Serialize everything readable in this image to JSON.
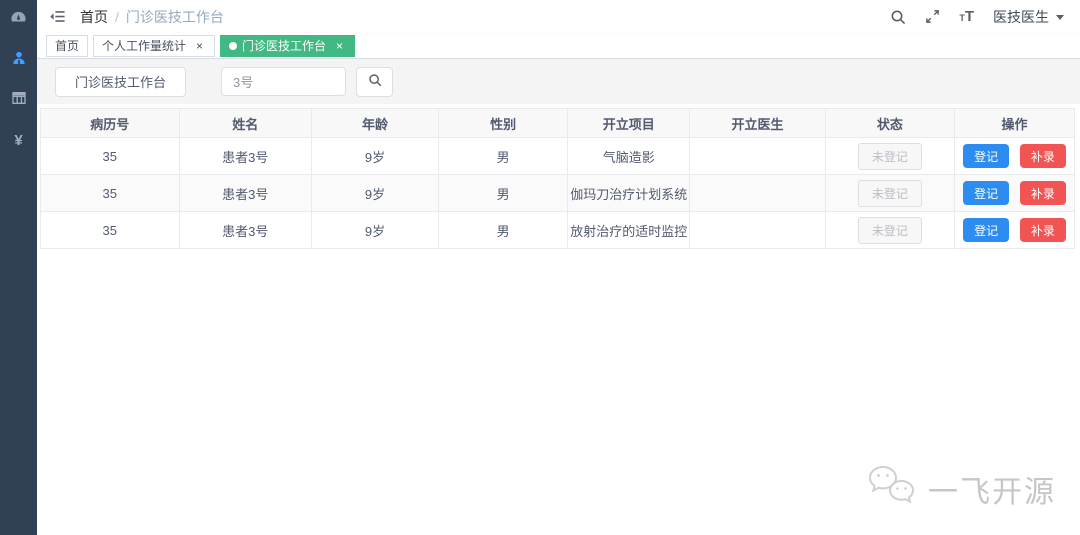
{
  "app": {
    "sidebar": {
      "items": [
        {
          "icon": "dashboard-icon"
        },
        {
          "icon": "doctor-icon",
          "active": true
        },
        {
          "icon": "table-icon"
        },
        {
          "icon": "money-icon",
          "glyph": "¥"
        }
      ]
    },
    "navbar": {
      "breadcrumb": {
        "root": "首页",
        "separator": "/",
        "current": "门诊医技工作台"
      },
      "user_name": "医技医生"
    },
    "glyphs": {
      "close": "×"
    },
    "tags_view": [
      {
        "label": "首页",
        "active": false,
        "closable": false
      },
      {
        "label": "个人工作量统计",
        "active": false,
        "closable": true
      },
      {
        "label": "门诊医技工作台",
        "active": true,
        "closable": true
      }
    ],
    "toolbar": {
      "workbench_button": "门诊医技工作台",
      "search_value": "3号"
    },
    "table": {
      "headers": [
        "病历号",
        "姓名",
        "年龄",
        "性别",
        "开立项目",
        "开立医生",
        "状态",
        "操作"
      ],
      "rows": [
        {
          "mrn": "35",
          "name": "患者3号",
          "age": "9岁",
          "gender": "男",
          "item": "气脑造影",
          "doctor": "",
          "status": "未登记"
        },
        {
          "mrn": "35",
          "name": "患者3号",
          "age": "9岁",
          "gender": "男",
          "item": "伽玛刀治疗计划系统",
          "doctor": "",
          "status": "未登记"
        },
        {
          "mrn": "35",
          "name": "患者3号",
          "age": "9岁",
          "gender": "男",
          "item": "放射治疗的适时监控",
          "doctor": "",
          "status": "未登记"
        }
      ],
      "actions": {
        "register": "登记",
        "makeup": "补录"
      }
    },
    "watermark": {
      "text": "一飞开源"
    },
    "colors": {
      "sidebar_bg": "#304156",
      "active_tag": "#42b983",
      "primary_button": "#2d8cf0",
      "danger_button": "#f15453",
      "active_icon": "#409eff"
    }
  }
}
